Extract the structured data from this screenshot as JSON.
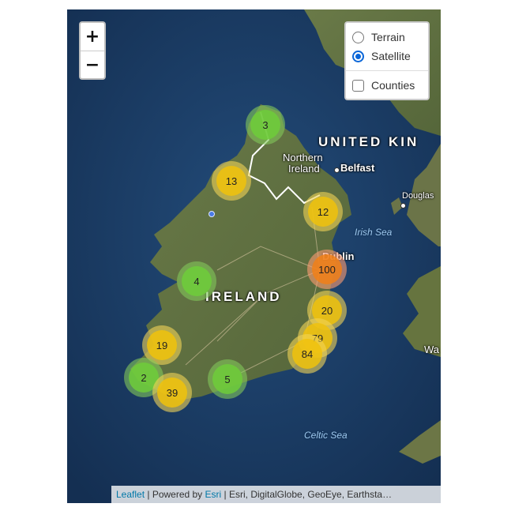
{
  "map": {
    "zoom_in": "+",
    "zoom_out": "−",
    "layers": {
      "terrain": "Terrain",
      "satellite": "Satellite",
      "selected": "satellite",
      "counties": "Counties",
      "counties_checked": false
    },
    "place_labels": {
      "united_kingdom": "UNITED KIN",
      "northern_ireland_1": "Northern",
      "northern_ireland_2": "Ireland",
      "belfast": "Belfast",
      "douglas": "Douglas",
      "irish_sea": "Irish Sea",
      "dublin": "Dublin",
      "ireland": "IRELAND",
      "wa": "Wa",
      "celtic_sea": "Celtic Sea"
    },
    "clusters": [
      {
        "count": "3",
        "level": "green"
      },
      {
        "count": "13",
        "level": "yellow"
      },
      {
        "count": "12",
        "level": "yellow"
      },
      {
        "count": "100",
        "level": "orange"
      },
      {
        "count": "4",
        "level": "green"
      },
      {
        "count": "20",
        "level": "yellow"
      },
      {
        "count": "79",
        "level": "yellow"
      },
      {
        "count": "84",
        "level": "yellow"
      },
      {
        "count": "19",
        "level": "yellow"
      },
      {
        "count": "2",
        "level": "green"
      },
      {
        "count": "39",
        "level": "yellow"
      },
      {
        "count": "5",
        "level": "green"
      }
    ],
    "attribution": {
      "leaflet": "Leaflet",
      "sep1": " | Powered by ",
      "esri": "Esri",
      "rest": " | Esri, DigitalGlobe, GeoEye, Earthsta…"
    },
    "colors": {
      "sea": "#1d3d66",
      "land": "#5b6b3e",
      "green_cluster": "#6ecc39",
      "yellow_cluster": "#f0c20c",
      "orange_cluster": "#f18017"
    }
  }
}
